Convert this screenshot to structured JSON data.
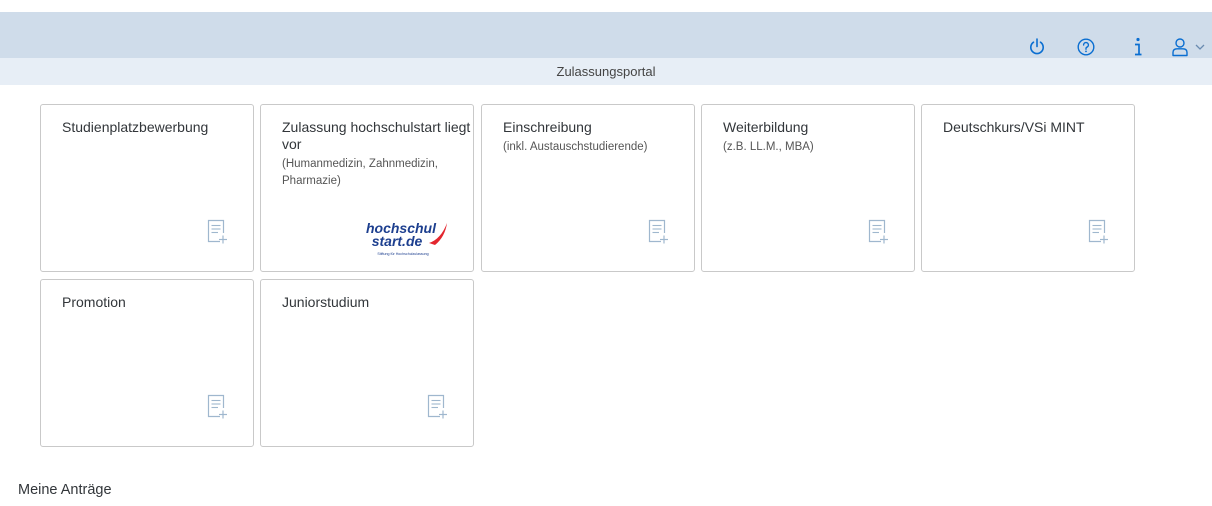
{
  "header": {
    "title": "Zulassungsportal",
    "icons": [
      "power-icon",
      "help-icon",
      "info-icon",
      "user-icon",
      "chevron-down-icon"
    ]
  },
  "tiles": [
    {
      "title": "Studienplatzbewerbung",
      "subtitle": "",
      "icon": "form-add-icon"
    },
    {
      "title": "Zulassung hochschulstart liegt vor",
      "subtitle": "(Humanmedizin, Zahnmedizin, Pharmazie)",
      "icon": "hochschulstart-logo",
      "logo": {
        "line1": "hochschul",
        "line2": "start.de",
        "tagline": "Stiftung für Hochschulzulassung"
      }
    },
    {
      "title": "Einschreibung",
      "subtitle": "(inkl. Austauschstudierende)",
      "icon": "form-add-icon"
    },
    {
      "title": "Weiterbildung",
      "subtitle": "(z.B. LL.M., MBA)",
      "icon": "form-add-icon"
    },
    {
      "title": "Deutschkurs/VSi MINT",
      "subtitle": "",
      "icon": "form-add-icon"
    },
    {
      "title": "Promotion",
      "subtitle": "",
      "icon": "form-add-icon"
    },
    {
      "title": "Juniorstudium",
      "subtitle": "",
      "icon": "form-add-icon"
    }
  ],
  "section": {
    "title": "Meine Anträge"
  },
  "colors": {
    "header_bg": "#cfdcea",
    "subheader_bg": "#e7eef6",
    "icon_blue": "#0a6ed1",
    "tile_icon": "#9fb7ce"
  }
}
